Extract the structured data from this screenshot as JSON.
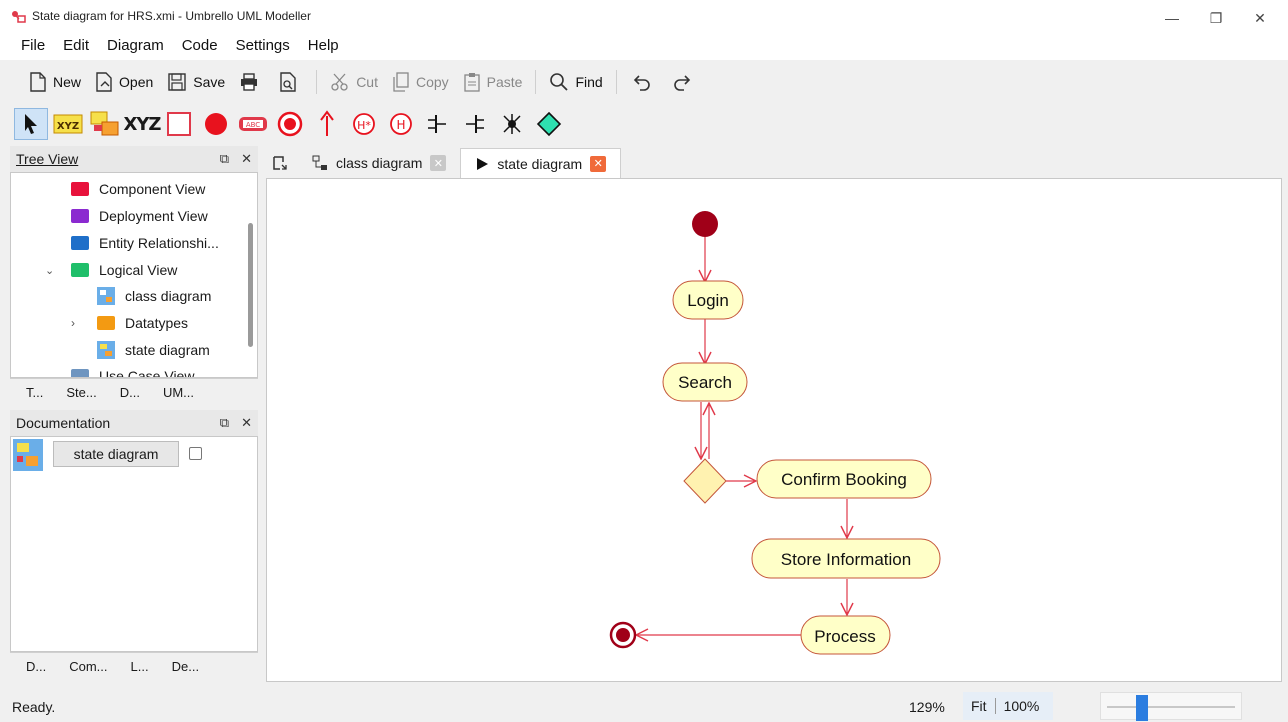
{
  "window": {
    "title": "State diagram for HRS.xmi  - Umbrello UML Modeller",
    "minimize": "—",
    "restore": "❐",
    "close": "✕"
  },
  "menu": [
    "File",
    "Edit",
    "Diagram",
    "Code",
    "Settings",
    "Help"
  ],
  "toolbar": {
    "new": "New",
    "open": "Open",
    "save": "Save",
    "cut": "Cut",
    "copy": "Copy",
    "paste": "Paste",
    "find": "Find"
  },
  "palette": {
    "xyz_label": "XYZ",
    "abc_label": "ABC",
    "history_deep": "H*",
    "history_shallow": "H"
  },
  "tree_view": {
    "title": "Tree View",
    "items": [
      {
        "label": "Component View",
        "color": "#e8123c"
      },
      {
        "label": "Deployment View",
        "color": "#8b2ad0"
      },
      {
        "label": "Entity Relationshi...",
        "color": "#1f6fc9"
      },
      {
        "label": "Logical View",
        "color": "#1fbf6a"
      },
      {
        "label": "class diagram"
      },
      {
        "label": "Datatypes",
        "color": "#f39a12"
      },
      {
        "label": "state diagram"
      },
      {
        "label": "Use Case View",
        "color": "#6e95c0"
      }
    ],
    "tabs": [
      "T...",
      "Ste...",
      "D...",
      "UM..."
    ]
  },
  "documentation": {
    "title": "Documentation",
    "button_label": "state diagram",
    "tabs": [
      "D...",
      "Com...",
      "L...",
      "De..."
    ]
  },
  "diagram_tabs": [
    {
      "label": "class diagram",
      "active": false
    },
    {
      "label": "state diagram",
      "active": true
    }
  ],
  "diagram": {
    "states": {
      "login": "Login",
      "search": "Search",
      "confirm": "Confirm Booking",
      "store": "Store Information",
      "process": "Process"
    },
    "colors": {
      "state_fill": "#ffffc8",
      "state_stroke": "#c4563a",
      "transition": "#e0394a",
      "initial": "#a00018"
    }
  },
  "status": {
    "message": "Ready.",
    "zoom": "129%",
    "fit": "Fit",
    "percent": "100%"
  }
}
